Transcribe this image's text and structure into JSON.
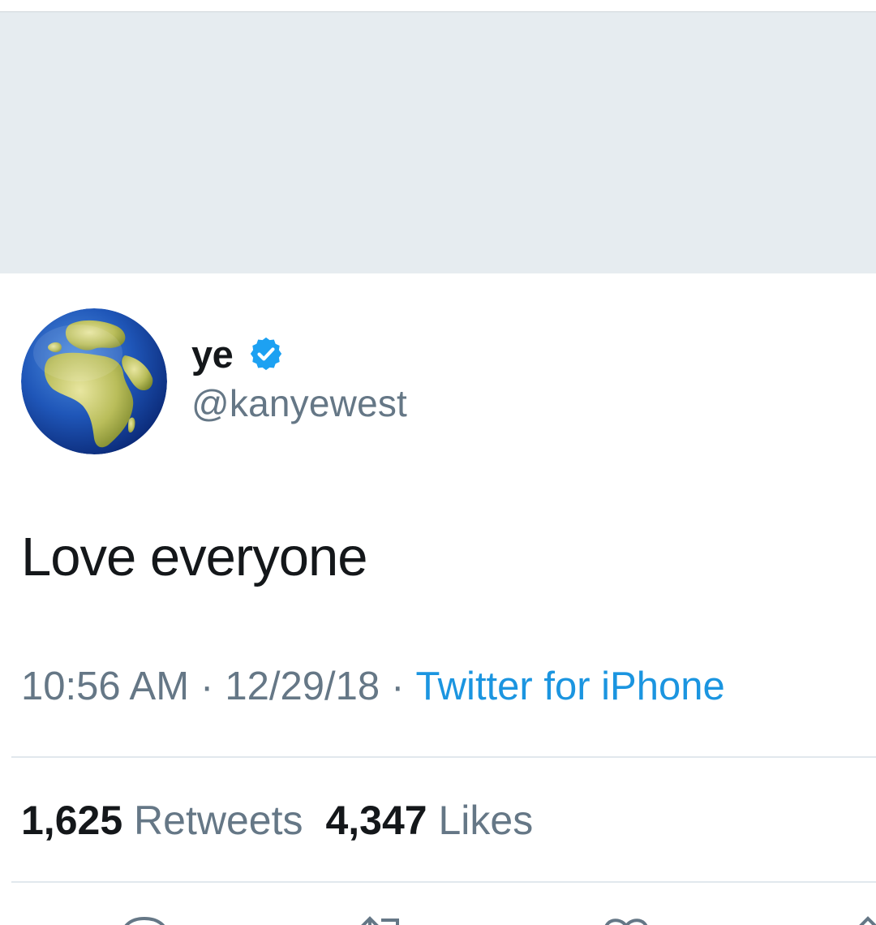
{
  "profile": {
    "display_name": "ye",
    "handle": "@kanyewest",
    "verified": true,
    "avatar_icon": "globe-europe-africa-icon"
  },
  "tweet": {
    "text": "Love everyone",
    "time": "10:56 AM",
    "date": "12/29/18",
    "separator": "·",
    "source": "Twitter for iPhone"
  },
  "stats": {
    "retweets_count": "1,625",
    "retweets_label": "Retweets",
    "likes_count": "4,347",
    "likes_label": "Likes"
  },
  "colors": {
    "banner": "#e6ecf0",
    "text": "#14171a",
    "secondary": "#657786",
    "accent": "#1b95e0",
    "verified": "#1da1f2"
  },
  "actions": [
    "reply-icon",
    "retweet-icon",
    "like-icon",
    "share-icon"
  ]
}
